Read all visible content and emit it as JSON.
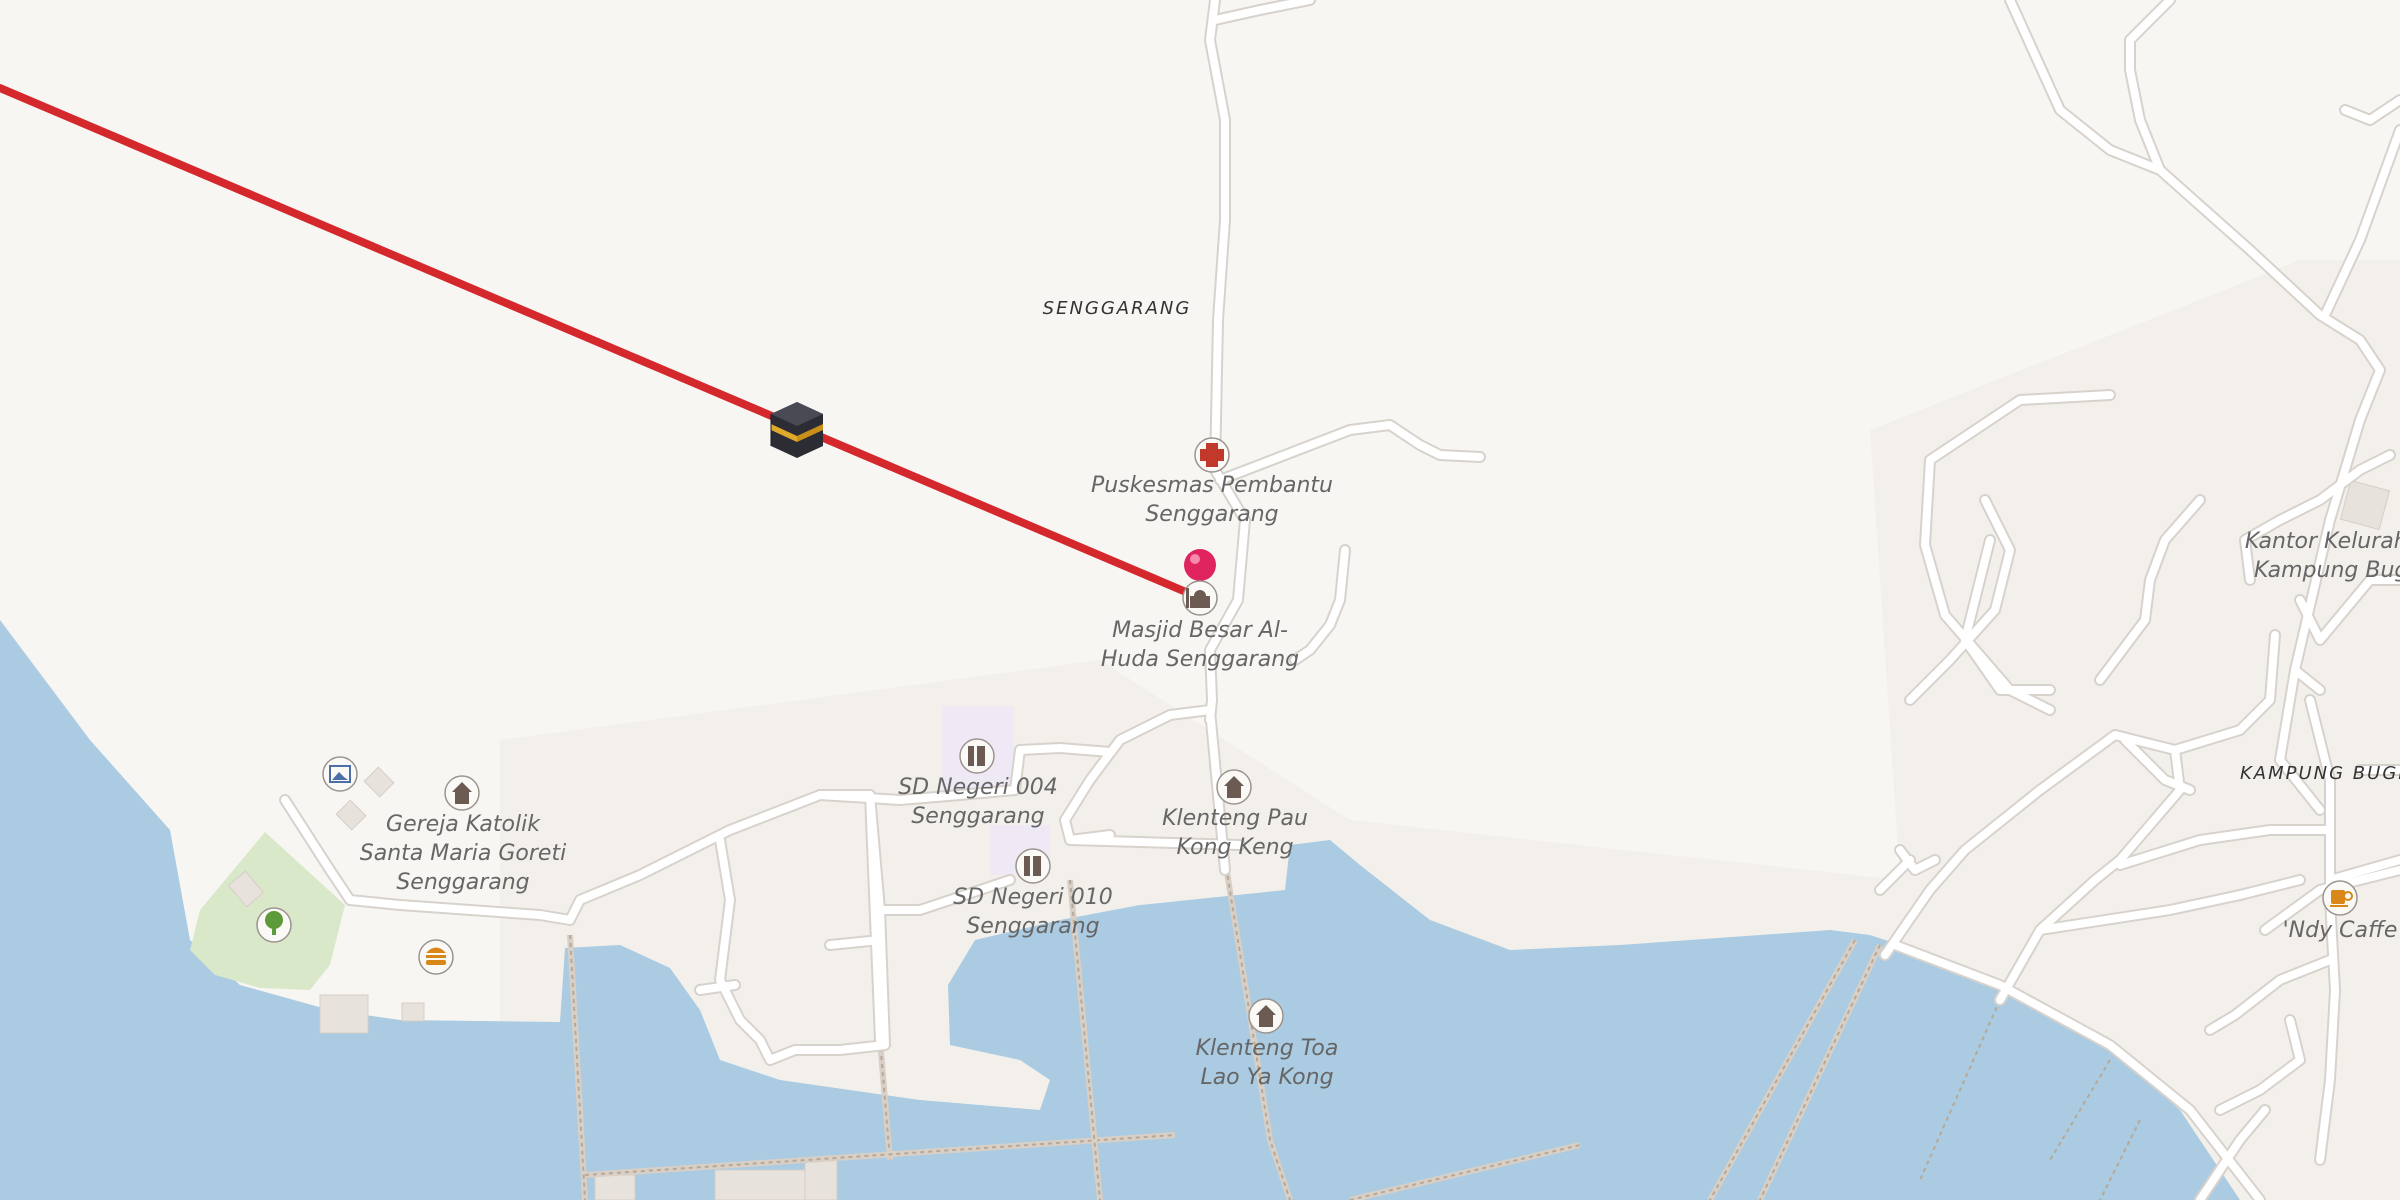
{
  "map": {
    "colors": {
      "land": "#f8f6f3",
      "water": "#aacbe1",
      "park": "#d9e8c8",
      "school": "#efe9f6",
      "route": "#d4282c",
      "marker": "#e0245e",
      "road": "#ffffff"
    },
    "labels": {
      "place_senggarang": "SENGGARANG",
      "place_kampung_bugis": "KAMPUNG BUGIS",
      "puskesmas_1": "Puskesmas Pembantu",
      "puskesmas_2": "Senggarang",
      "masjid_1": "Masjid Besar Al-",
      "masjid_2": "Huda Senggarang",
      "sd004_1": "SD Negeri 004",
      "sd004_2": "Senggarang",
      "sd010_1": "SD Negeri 010",
      "sd010_2": "Senggarang",
      "klenteng_pau_1": "Klenteng Pau",
      "klenteng_pau_2": "Kong Keng",
      "klenteng_toa_1": "Klenteng Toa",
      "klenteng_toa_2": "Lao Ya Kong",
      "gereja_1": "Gereja Katolik",
      "gereja_2": "Santa Maria Goreti",
      "gereja_3": "Senggarang",
      "kantor_1": "Kantor Kelurahan",
      "kantor_2": "Kampung Bugis",
      "cafe": "'Ndy Caffe"
    },
    "icons": {
      "route_destination": "kaaba-icon",
      "location_marker": "map-pin-icon",
      "health": "medical-cross-icon",
      "mosque": "mosque-icon",
      "school": "school-icon",
      "temple": "temple-icon",
      "church": "church-icon",
      "viewpoint": "gallery-icon",
      "park": "tree-icon",
      "food": "burger-icon",
      "cafe": "coffee-cup-icon"
    }
  }
}
